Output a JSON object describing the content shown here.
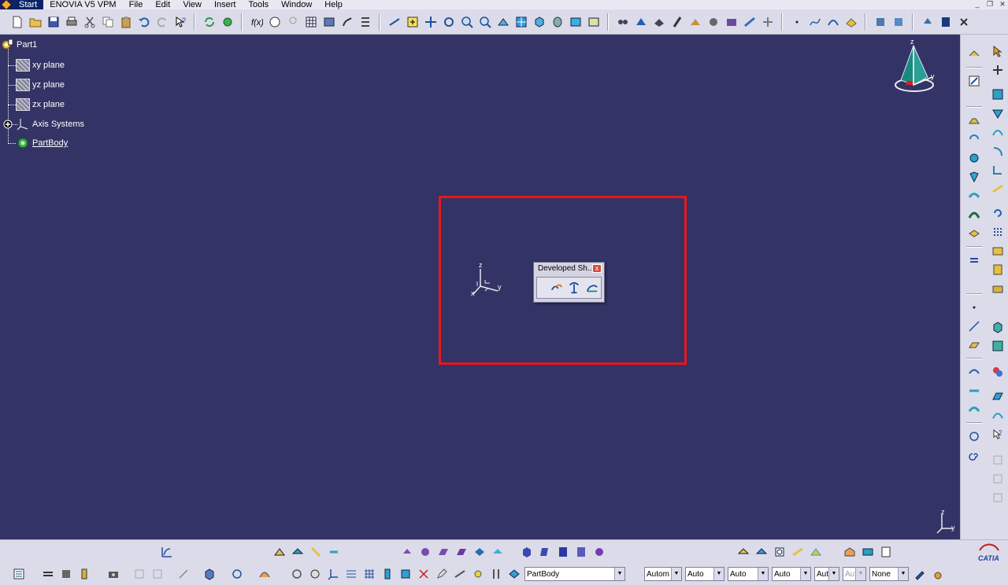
{
  "menubar": {
    "items": [
      "Start",
      "ENOVIA V5 VPM",
      "File",
      "Edit",
      "View",
      "Insert",
      "Tools",
      "Window",
      "Help"
    ]
  },
  "window_controls": [
    "_",
    "❐",
    "✕"
  ],
  "spec_tree": {
    "root": "Part1",
    "nodes": [
      {
        "label": "xy plane",
        "icon": "plane-icon"
      },
      {
        "label": "yz plane",
        "icon": "plane-icon"
      },
      {
        "label": "zx plane",
        "icon": "plane-icon"
      },
      {
        "label": "Axis Systems",
        "icon": "axis-systems-icon"
      },
      {
        "label": "PartBody",
        "icon": "part-body-icon"
      }
    ]
  },
  "axis_labels": {
    "x": "x",
    "y": "y",
    "z": "z"
  },
  "floating_toolbar": {
    "title": "Developed Sh...",
    "close": "x"
  },
  "bottom_combos": {
    "current_body": "PartBody",
    "values": [
      "Autom",
      "Auto",
      "Auto",
      "Auto",
      "Aut",
      "Aut",
      "None"
    ]
  },
  "colors": {
    "viewport_bg": "#333366",
    "toolbar_bg": "#dcdbe9",
    "highlight": "#e8171b"
  }
}
